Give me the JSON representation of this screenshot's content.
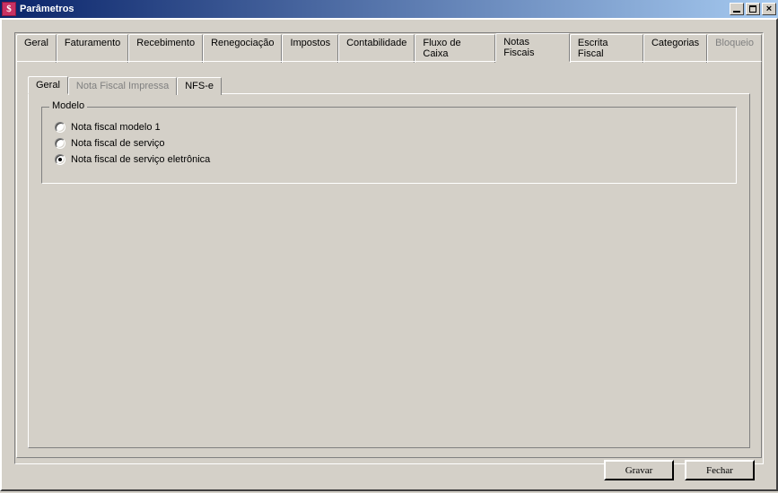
{
  "window": {
    "title": "Parâmetros",
    "icon_glyph": "$"
  },
  "tabs": {
    "geral": "Geral",
    "faturamento": "Faturamento",
    "recebimento": "Recebimento",
    "renegociacao": "Renegociação",
    "impostos": "Impostos",
    "contabilidade": "Contabilidade",
    "fluxo": "Fluxo de Caixa",
    "notas_fiscais": "Notas Fiscais",
    "escrita_fiscal": "Escrita Fiscal",
    "categorias": "Categorias",
    "bloqueio": "Bloqueio"
  },
  "subtabs": {
    "geral": "Geral",
    "nf_impressa": "Nota Fiscal Impressa",
    "nfse": "NFS-e"
  },
  "modelo": {
    "legend": "Modelo",
    "opt1": "Nota fiscal modelo 1",
    "opt2": "Nota fiscal de serviço",
    "opt3": "Nota fiscal de serviço eletrônica"
  },
  "buttons": {
    "gravar": "Gravar",
    "fechar": "Fechar"
  }
}
